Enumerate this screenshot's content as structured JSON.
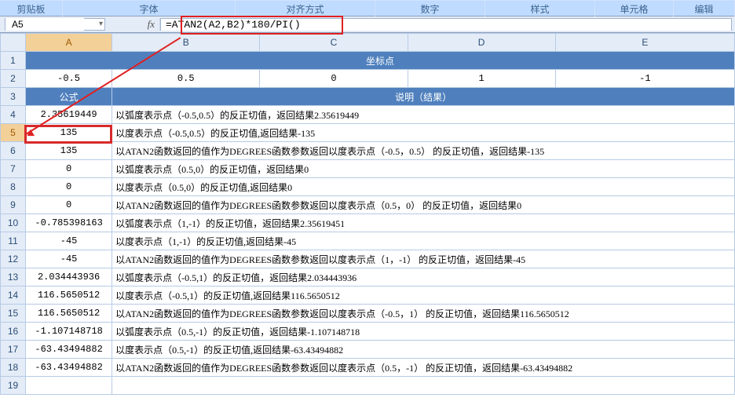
{
  "ribbon": {
    "groups": [
      "剪贴板",
      "字体",
      "对齐方式",
      "数字",
      "样式",
      "单元格",
      "编辑"
    ],
    "group_widths": [
      80,
      220,
      178,
      140,
      140,
      100,
      78
    ]
  },
  "formula_bar": {
    "name_box_value": "A5",
    "fx_label": "fx",
    "formula_value": "=ATAN2(A2,B2)*180/PI()"
  },
  "columns": [
    "A",
    "B",
    "C",
    "D",
    "E"
  ],
  "selected_col": "A",
  "selected_row": 5,
  "row1_banner": "坐标点",
  "row2_values": [
    "-0.5",
    "0.5",
    "0",
    "1",
    "-1"
  ],
  "row3_label_a": "公式",
  "row3_banner": "说明（结果）",
  "rows": [
    {
      "n": 4,
      "val": "2.35619449",
      "desc": "以弧度表示点（-0.5,0.5）的反正切值，返回结果2.35619449"
    },
    {
      "n": 5,
      "val": "135",
      "desc": "以度表示点（-0.5,0.5）的反正切值,返回结果-135"
    },
    {
      "n": 6,
      "val": "135",
      "desc": "以ATAN2函数返回的值作为DEGREES函数参数返回以度表示点（-0.5，0.5） 的反正切值，返回结果-135"
    },
    {
      "n": 7,
      "val": "0",
      "desc": "以弧度表示点（0.5,0）的反正切值，返回结果0"
    },
    {
      "n": 8,
      "val": "0",
      "desc": "以度表示点（0.5,0）的反正切值,返回结果0"
    },
    {
      "n": 9,
      "val": "0",
      "desc": "以ATAN2函数返回的值作为DEGREES函数参数返回以度表示点（0.5，0） 的反正切值，返回结果0"
    },
    {
      "n": 10,
      "val": "-0.785398163",
      "desc": "以弧度表示点（1,-1）的反正切值，返回结果2.35619451"
    },
    {
      "n": 11,
      "val": "-45",
      "desc": "以度表示点（1,-1）的反正切值,返回结果-45"
    },
    {
      "n": 12,
      "val": "-45",
      "desc": "以ATAN2函数返回的值作为DEGREES函数参数返回以度表示点（1，-1） 的反正切值，返回结果-45"
    },
    {
      "n": 13,
      "val": "2.034443936",
      "desc": "以弧度表示点（-0.5,1）的反正切值，返回结果2.034443936"
    },
    {
      "n": 14,
      "val": "116.5650512",
      "desc": "以度表示点（-0.5,1）的反正切值,返回结果116.5650512"
    },
    {
      "n": 15,
      "val": "116.5650512",
      "desc": "以ATAN2函数返回的值作为DEGREES函数参数返回以度表示点（-0.5，1） 的反正切值，返回结果116.5650512"
    },
    {
      "n": 16,
      "val": "-1.107148718",
      "desc": "以弧度表示点（0.5,-1）的反正切值，返回结果-1.107148718"
    },
    {
      "n": 17,
      "val": "-63.43494882",
      "desc": "以度表示点（0.5,-1）的反正切值,返回结果-63.43494882"
    },
    {
      "n": 18,
      "val": "-63.43494882",
      "desc": "以ATAN2函数返回的值作为DEGREES函数参数返回以度表示点（0.5，-1） 的反正切值，返回结果-63.43494882"
    }
  ]
}
